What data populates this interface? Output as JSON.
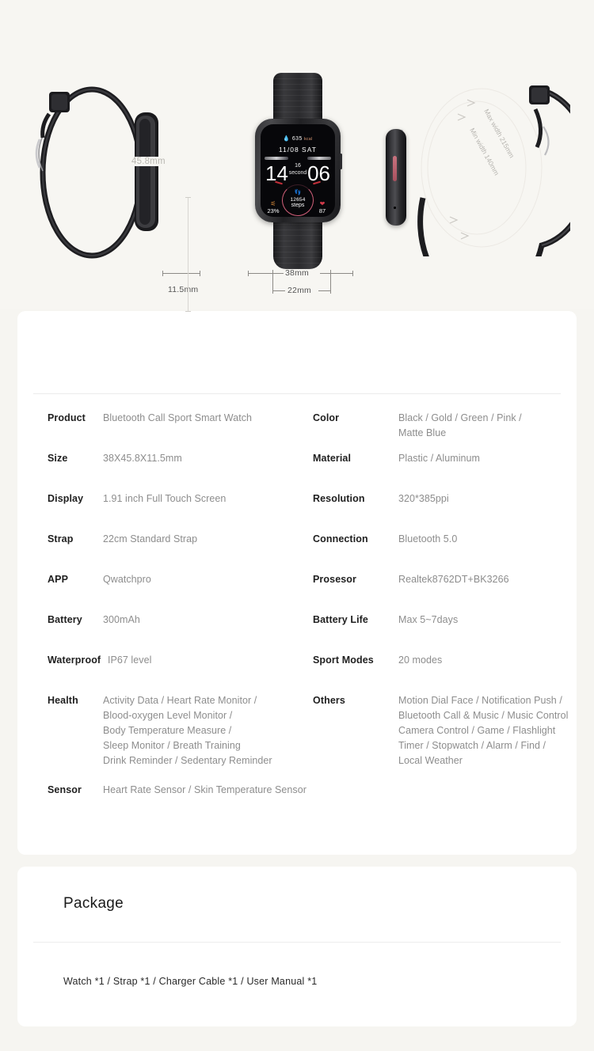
{
  "hero": {
    "dimensions": {
      "height_label": "45.8mm",
      "thickness_label": "11.5mm",
      "case_width_label": "38mm",
      "strap_width_label": "22mm",
      "max_width_label": "Max width 215mm",
      "min_width_label": "Min width 140mm"
    },
    "watchface": {
      "drop_icon": "droplet-icon",
      "calories": "635",
      "calories_unit": "kcal",
      "date": "11/08 SAT",
      "hour": "14",
      "minute": "06",
      "seconds_value": "16",
      "seconds_label": "second",
      "battery": "23%",
      "battery_icon": "battery-icon",
      "steps_value": "12654",
      "steps_label": "steps",
      "steps_icon": "footsteps-icon",
      "heart_rate": "87",
      "heart_icon": "heart-icon"
    }
  },
  "spec": {
    "left_rows": [
      {
        "label": "Product",
        "lines": [
          "Bluetooth Call Sport Smart Watch"
        ]
      },
      {
        "label": "Size",
        "lines": [
          "38X45.8X11.5mm"
        ]
      },
      {
        "label": "Display",
        "lines": [
          "1.91 inch Full Touch Screen"
        ]
      },
      {
        "label": "Strap",
        "lines": [
          "22cm Standard Strap"
        ]
      },
      {
        "label": "APP",
        "lines": [
          "Qwatchpro"
        ]
      },
      {
        "label": "Battery",
        "lines": [
          "300mAh"
        ]
      },
      {
        "label": "Waterproof",
        "lines": [
          "IP67 level"
        ]
      },
      {
        "label": "Health",
        "lines": [
          "Activity Data / Heart Rate Monitor /",
          "Blood-oxygen Level Monitor /",
          "Body Temperature Measure /",
          "Sleep Monitor / Breath Training",
          "Drink Reminder / Sedentary Reminder"
        ]
      },
      {
        "label": "Sensor",
        "lines": [
          "Heart Rate Sensor / Skin Temperature Sensor"
        ]
      }
    ],
    "right_rows": [
      {
        "label": "Color",
        "lines": [
          "Black / Gold / Green / Pink /",
          "Matte Blue"
        ]
      },
      {
        "label": "Material",
        "lines": [
          "Plastic / Aluminum"
        ]
      },
      {
        "label": "Resolution",
        "lines": [
          "320*385ppi"
        ]
      },
      {
        "label": "Connection",
        "lines": [
          "Bluetooth 5.0"
        ]
      },
      {
        "label": "Prosesor",
        "lines": [
          "Realtek8762DT+BK3266"
        ]
      },
      {
        "label": "Battery Life",
        "lines": [
          "Max 5~7days"
        ]
      },
      {
        "label": "Sport Modes",
        "lines": [
          "20 modes"
        ]
      },
      {
        "label": "Others",
        "lines": [
          "Motion Dial Face / Notification Push /",
          "Bluetooth Call & Music / Music Control",
          "Camera Control / Game / Flashlight",
          "Timer / Stopwatch / Alarm / Find /",
          "Local Weather"
        ]
      }
    ]
  },
  "package": {
    "title": "Package",
    "contents": "Watch  *1  /  Strap *1  /  Charger Cable *1  /  User Manual *1"
  },
  "colors": {
    "page_bg": "#f6f5f1",
    "card_bg": "#ffffff",
    "label": "#1f1f1f",
    "value": "#8d8d8d",
    "divider": "#ececec",
    "dim_text": "#b9b7b2",
    "accent_button": "#c9737f"
  }
}
